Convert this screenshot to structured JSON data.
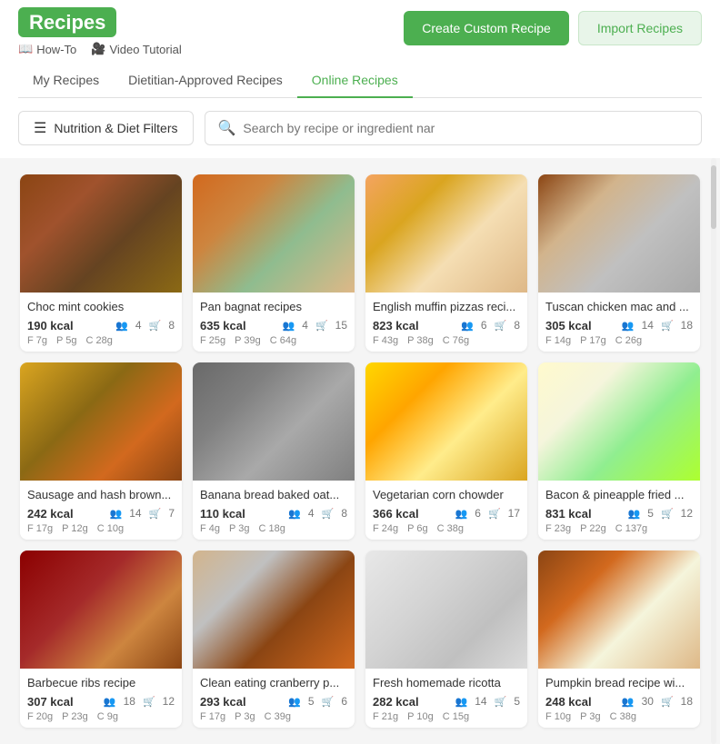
{
  "app": {
    "logo": "Recipes",
    "header_links": [
      {
        "icon": "book-icon",
        "label": "How-To"
      },
      {
        "icon": "video-icon",
        "label": "Video Tutorial"
      }
    ],
    "buttons": {
      "create": "Create Custom Recipe",
      "import": "Import Recipes"
    },
    "nav": {
      "items": [
        {
          "label": "My Recipes",
          "active": false
        },
        {
          "label": "Dietitian-Approved Recipes",
          "active": false
        },
        {
          "label": "Online Recipes",
          "active": true
        }
      ]
    }
  },
  "controls": {
    "filter_label": "Nutrition & Diet Filters",
    "search_placeholder": "Search by recipe or ingredient nar"
  },
  "recipes": [
    {
      "name": "Choc mint cookies",
      "kcal": "190 kcal",
      "servings": "4",
      "cart": "8",
      "fat": "F 7g",
      "protein": "P 5g",
      "carbs": "C 28g",
      "img_class": "img-choc"
    },
    {
      "name": "Pan bagnat recipes",
      "kcal": "635 kcal",
      "servings": "4",
      "cart": "15",
      "fat": "F 25g",
      "protein": "P 39g",
      "carbs": "C 64g",
      "img_class": "img-pan"
    },
    {
      "name": "English muffin pizzas reci...",
      "kcal": "823 kcal",
      "servings": "6",
      "cart": "8",
      "fat": "F 43g",
      "protein": "P 38g",
      "carbs": "C 76g",
      "img_class": "img-muffin"
    },
    {
      "name": "Tuscan chicken mac and ...",
      "kcal": "305 kcal",
      "servings": "14",
      "cart": "18",
      "fat": "F 14g",
      "protein": "P 17g",
      "carbs": "C 26g",
      "img_class": "img-tuscan"
    },
    {
      "name": "Sausage and hash brown...",
      "kcal": "242 kcal",
      "servings": "14",
      "cart": "7",
      "fat": "F 17g",
      "protein": "P 12g",
      "carbs": "C 10g",
      "img_class": "img-sausage"
    },
    {
      "name": "Banana bread baked oat...",
      "kcal": "110 kcal",
      "servings": "4",
      "cart": "8",
      "fat": "F 4g",
      "protein": "P 3g",
      "carbs": "C 18g",
      "img_class": "img-banana"
    },
    {
      "name": "Vegetarian corn chowder",
      "kcal": "366 kcal",
      "servings": "6",
      "cart": "17",
      "fat": "F 24g",
      "protein": "P 6g",
      "carbs": "C 38g",
      "img_class": "img-corn"
    },
    {
      "name": "Bacon & pineapple fried ...",
      "kcal": "831 kcal",
      "servings": "5",
      "cart": "12",
      "fat": "F 23g",
      "protein": "P 22g",
      "carbs": "C 137g",
      "img_class": "img-bacon"
    },
    {
      "name": "Barbecue ribs recipe",
      "kcal": "307 kcal",
      "servings": "18",
      "cart": "12",
      "fat": "F 20g",
      "protein": "P 23g",
      "carbs": "C 9g",
      "img_class": "img-bbq"
    },
    {
      "name": "Clean eating cranberry p...",
      "kcal": "293 kcal",
      "servings": "5",
      "cart": "6",
      "fat": "F 17g",
      "protein": "P 3g",
      "carbs": "C 39g",
      "img_class": "img-cranberry"
    },
    {
      "name": "Fresh homemade ricotta",
      "kcal": "282 kcal",
      "servings": "14",
      "cart": "5",
      "fat": "F 21g",
      "protein": "P 10g",
      "carbs": "C 15g",
      "img_class": "img-ricotta"
    },
    {
      "name": "Pumpkin bread recipe wi...",
      "kcal": "248 kcal",
      "servings": "30",
      "cart": "18",
      "fat": "F 10g",
      "protein": "P 3g",
      "carbs": "C 38g",
      "img_class": "img-pumpkin"
    }
  ]
}
